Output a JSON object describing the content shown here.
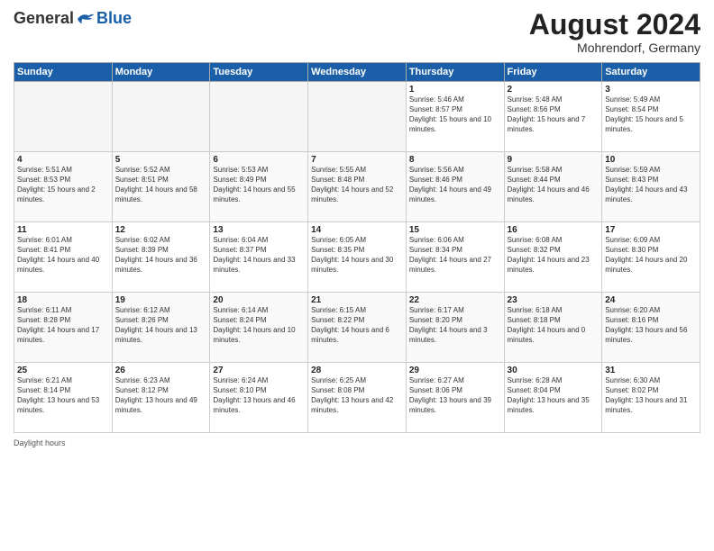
{
  "header": {
    "logo_general": "General",
    "logo_blue": "Blue",
    "month_title": "August 2024",
    "location": "Mohrendorf, Germany"
  },
  "days_of_week": [
    "Sunday",
    "Monday",
    "Tuesday",
    "Wednesday",
    "Thursday",
    "Friday",
    "Saturday"
  ],
  "weeks": [
    [
      {
        "day": "",
        "empty": true
      },
      {
        "day": "",
        "empty": true
      },
      {
        "day": "",
        "empty": true
      },
      {
        "day": "",
        "empty": true
      },
      {
        "day": "1",
        "sunrise": "5:46 AM",
        "sunset": "8:57 PM",
        "daylight": "15 hours and 10 minutes."
      },
      {
        "day": "2",
        "sunrise": "5:48 AM",
        "sunset": "8:56 PM",
        "daylight": "15 hours and 7 minutes."
      },
      {
        "day": "3",
        "sunrise": "5:49 AM",
        "sunset": "8:54 PM",
        "daylight": "15 hours and 5 minutes."
      }
    ],
    [
      {
        "day": "4",
        "sunrise": "5:51 AM",
        "sunset": "8:53 PM",
        "daylight": "15 hours and 2 minutes."
      },
      {
        "day": "5",
        "sunrise": "5:52 AM",
        "sunset": "8:51 PM",
        "daylight": "14 hours and 58 minutes."
      },
      {
        "day": "6",
        "sunrise": "5:53 AM",
        "sunset": "8:49 PM",
        "daylight": "14 hours and 55 minutes."
      },
      {
        "day": "7",
        "sunrise": "5:55 AM",
        "sunset": "8:48 PM",
        "daylight": "14 hours and 52 minutes."
      },
      {
        "day": "8",
        "sunrise": "5:56 AM",
        "sunset": "8:46 PM",
        "daylight": "14 hours and 49 minutes."
      },
      {
        "day": "9",
        "sunrise": "5:58 AM",
        "sunset": "8:44 PM",
        "daylight": "14 hours and 46 minutes."
      },
      {
        "day": "10",
        "sunrise": "5:59 AM",
        "sunset": "8:43 PM",
        "daylight": "14 hours and 43 minutes."
      }
    ],
    [
      {
        "day": "11",
        "sunrise": "6:01 AM",
        "sunset": "8:41 PM",
        "daylight": "14 hours and 40 minutes."
      },
      {
        "day": "12",
        "sunrise": "6:02 AM",
        "sunset": "8:39 PM",
        "daylight": "14 hours and 36 minutes."
      },
      {
        "day": "13",
        "sunrise": "6:04 AM",
        "sunset": "8:37 PM",
        "daylight": "14 hours and 33 minutes."
      },
      {
        "day": "14",
        "sunrise": "6:05 AM",
        "sunset": "8:35 PM",
        "daylight": "14 hours and 30 minutes."
      },
      {
        "day": "15",
        "sunrise": "6:06 AM",
        "sunset": "8:34 PM",
        "daylight": "14 hours and 27 minutes."
      },
      {
        "day": "16",
        "sunrise": "6:08 AM",
        "sunset": "8:32 PM",
        "daylight": "14 hours and 23 minutes."
      },
      {
        "day": "17",
        "sunrise": "6:09 AM",
        "sunset": "8:30 PM",
        "daylight": "14 hours and 20 minutes."
      }
    ],
    [
      {
        "day": "18",
        "sunrise": "6:11 AM",
        "sunset": "8:28 PM",
        "daylight": "14 hours and 17 minutes."
      },
      {
        "day": "19",
        "sunrise": "6:12 AM",
        "sunset": "8:26 PM",
        "daylight": "14 hours and 13 minutes."
      },
      {
        "day": "20",
        "sunrise": "6:14 AM",
        "sunset": "8:24 PM",
        "daylight": "14 hours and 10 minutes."
      },
      {
        "day": "21",
        "sunrise": "6:15 AM",
        "sunset": "8:22 PM",
        "daylight": "14 hours and 6 minutes."
      },
      {
        "day": "22",
        "sunrise": "6:17 AM",
        "sunset": "8:20 PM",
        "daylight": "14 hours and 3 minutes."
      },
      {
        "day": "23",
        "sunrise": "6:18 AM",
        "sunset": "8:18 PM",
        "daylight": "14 hours and 0 minutes."
      },
      {
        "day": "24",
        "sunrise": "6:20 AM",
        "sunset": "8:16 PM",
        "daylight": "13 hours and 56 minutes."
      }
    ],
    [
      {
        "day": "25",
        "sunrise": "6:21 AM",
        "sunset": "8:14 PM",
        "daylight": "13 hours and 53 minutes."
      },
      {
        "day": "26",
        "sunrise": "6:23 AM",
        "sunset": "8:12 PM",
        "daylight": "13 hours and 49 minutes."
      },
      {
        "day": "27",
        "sunrise": "6:24 AM",
        "sunset": "8:10 PM",
        "daylight": "13 hours and 46 minutes."
      },
      {
        "day": "28",
        "sunrise": "6:25 AM",
        "sunset": "8:08 PM",
        "daylight": "13 hours and 42 minutes."
      },
      {
        "day": "29",
        "sunrise": "6:27 AM",
        "sunset": "8:06 PM",
        "daylight": "13 hours and 39 minutes."
      },
      {
        "day": "30",
        "sunrise": "6:28 AM",
        "sunset": "8:04 PM",
        "daylight": "13 hours and 35 minutes."
      },
      {
        "day": "31",
        "sunrise": "6:30 AM",
        "sunset": "8:02 PM",
        "daylight": "13 hours and 31 minutes."
      }
    ]
  ],
  "footer": {
    "note": "Daylight hours"
  }
}
